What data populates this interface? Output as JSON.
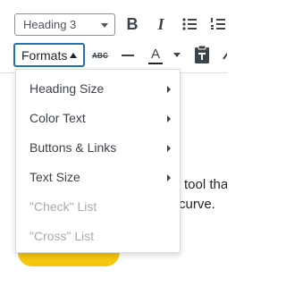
{
  "toolbar": {
    "block_format_value": "Heading 3",
    "bold_label": "B",
    "italic_label": "I",
    "formats_label": "Formats",
    "strikethrough_label": "ABC",
    "text_color_label": "A"
  },
  "formats_menu": {
    "items": [
      {
        "label": "Heading Size",
        "has_submenu": true,
        "enabled": true
      },
      {
        "label": "Color Text",
        "has_submenu": true,
        "enabled": true
      },
      {
        "label": "Buttons & Links",
        "has_submenu": true,
        "enabled": true
      },
      {
        "label": "Text Size",
        "has_submenu": true,
        "enabled": true
      },
      {
        "label": "\"Check\" List",
        "has_submenu": false,
        "enabled": false
      },
      {
        "label": "\"Cross\" List",
        "has_submenu": false,
        "enabled": false
      }
    ]
  },
  "editor": {
    "line1": "tool tha",
    "line2": "curve."
  },
  "colors": {
    "accent": "#2271b1",
    "button_yellow": "#f4c60c",
    "disabled_text": "#a7aaad"
  }
}
